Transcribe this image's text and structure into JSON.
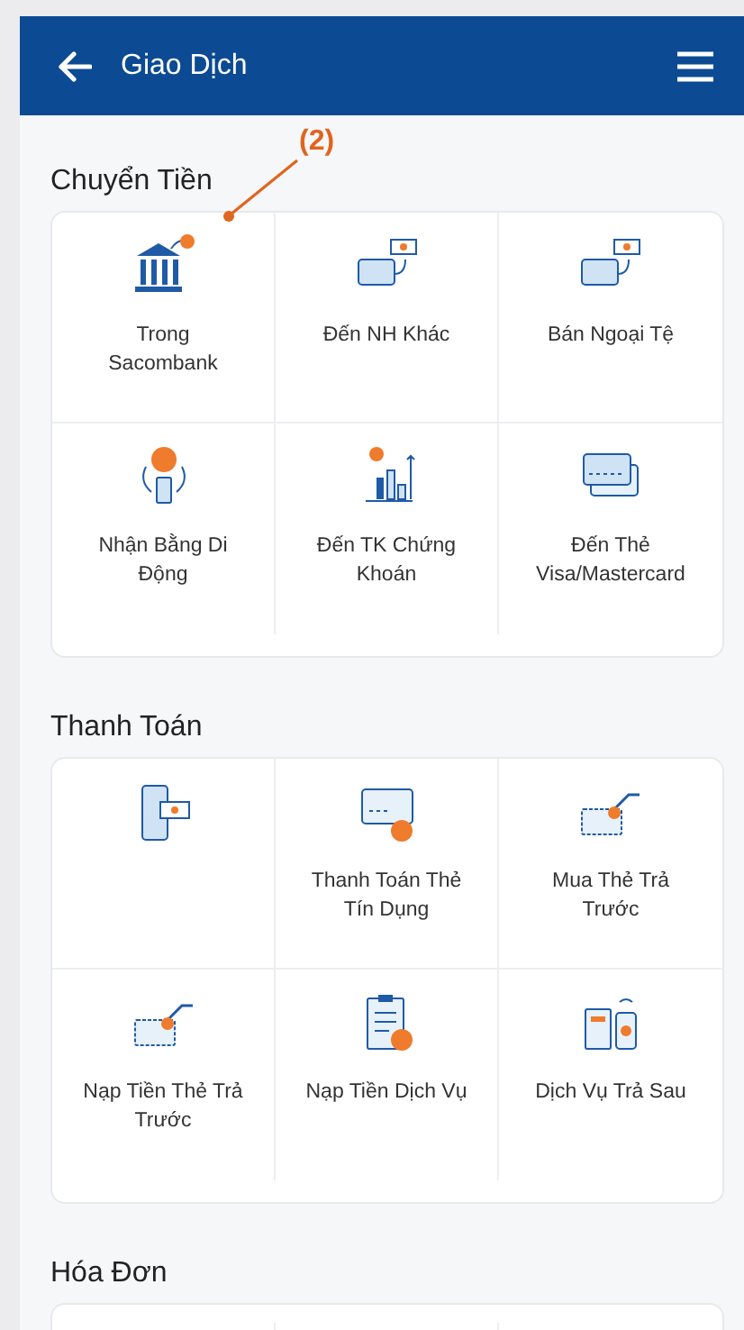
{
  "header": {
    "title": "Giao Dịch"
  },
  "annotation": {
    "label": "(2)"
  },
  "sections": [
    {
      "title": "Chuyển Tiền",
      "items": [
        {
          "kind": "bank",
          "label": "Trong Sacombank"
        },
        {
          "kind": "transfer",
          "label": "Đến NH Khác"
        },
        {
          "kind": "transfer",
          "label": "Bán Ngoại Tệ"
        },
        {
          "kind": "phone",
          "label": "Nhận Bằng Di Động"
        },
        {
          "kind": "chart",
          "label": "Đến TK Chứng Khoán"
        },
        {
          "kind": "cards",
          "label": "Đến Thẻ Visa/Mastercard"
        }
      ]
    },
    {
      "title": "Thanh Toán",
      "items": [
        {
          "kind": "bill"
        },
        {
          "kind": "credit",
          "label": "Thanh Toán Thẻ Tín Dụng"
        },
        {
          "kind": "hand",
          "label": "Mua Thẻ Trả Trước"
        },
        {
          "kind": "hand",
          "label": "Nạp Tiền Thẻ Trả Trước"
        },
        {
          "kind": "clipboard",
          "label": "Nạp Tiền Dịch Vụ"
        },
        {
          "kind": "pos",
          "label": "Dịch Vụ Trả Sau"
        }
      ]
    },
    {
      "title": "Hóa Đơn"
    }
  ]
}
